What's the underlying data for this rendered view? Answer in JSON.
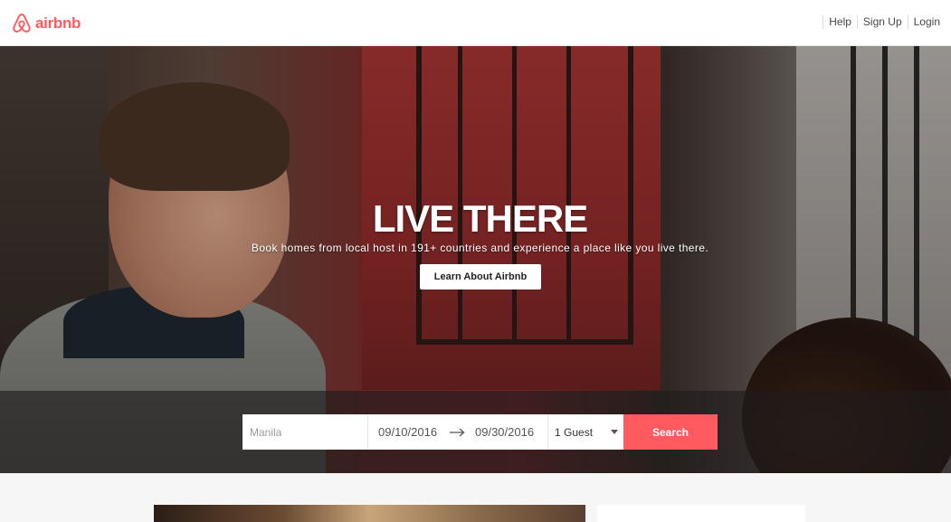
{
  "header": {
    "logo_text": "airbnb",
    "nav": [
      "Help",
      "Sign Up",
      "Login"
    ]
  },
  "hero": {
    "title": "LIVE THERE",
    "subtitle": "Book homes from local host in 191+ countries and experience a place like you live there.",
    "cta_label": "Learn About Airbnb"
  },
  "search": {
    "location_placeholder": "Manila",
    "check_in": "09/10/2016",
    "check_out": "09/30/2016",
    "guests": "1 Guest",
    "button_label": "Search"
  },
  "colors": {
    "brand": "#ff5a5f",
    "text": "#484848"
  },
  "icons": {
    "logo": "airbnb-belo-icon",
    "date_arrow": "arrow-right-icon",
    "guests_caret": "caret-down-icon"
  }
}
